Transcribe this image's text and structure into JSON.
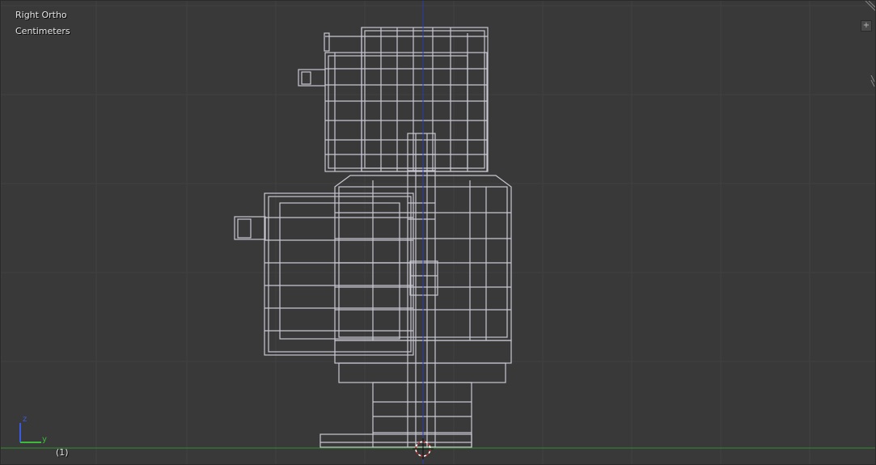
{
  "viewport": {
    "view_label": "Right Ortho",
    "units_label": "Centimeters",
    "frame_label": "(1)",
    "axis_labels": {
      "vertical": "z",
      "horizontal": "y"
    },
    "corner_button_glyph": "+",
    "colors": {
      "background": "#393939",
      "grid": "#414141",
      "wire": "#c8c8d2",
      "z_axis": "#2a3bb0",
      "ground": "#2f8f2f",
      "cursor": "#cc2222"
    }
  }
}
